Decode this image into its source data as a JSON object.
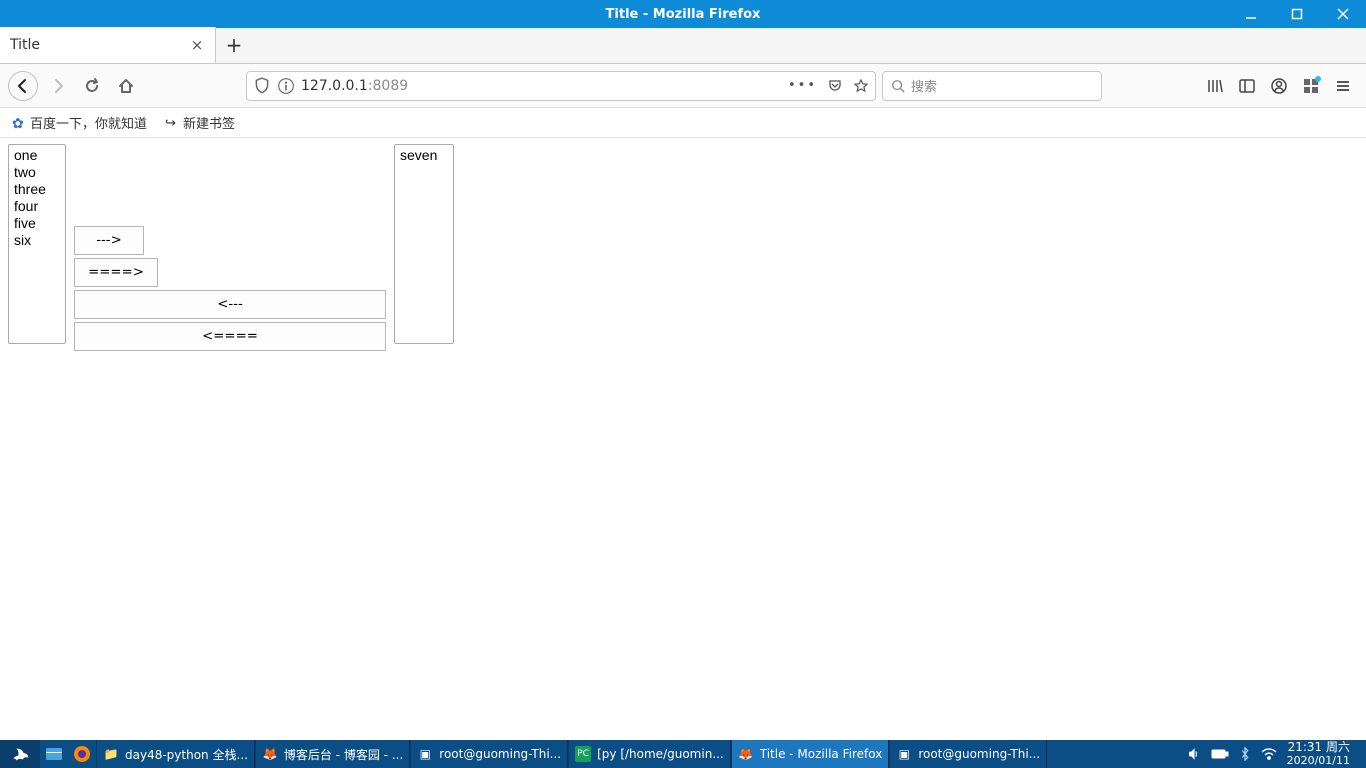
{
  "window": {
    "title": "Title - Mozilla Firefox"
  },
  "tab": {
    "title": "Title"
  },
  "url": {
    "host": "127.0.0.1",
    "port": ":8089"
  },
  "search": {
    "placeholder": "搜索"
  },
  "bookmarks": {
    "baidu": "百度一下，你就知道",
    "newbm": "新建书签"
  },
  "left_list": [
    "one",
    "two",
    "three",
    "four",
    "five",
    "six"
  ],
  "right_list": [
    "seven"
  ],
  "buttons": {
    "right1": "--->",
    "right_all": "====>",
    "left1": "<---",
    "left_all": "<===="
  },
  "tasks": {
    "t1": "day48-python 全栈...",
    "t2": "博客后台 - 博客园 - ...",
    "t3": "root@guoming-Thi...",
    "t4": "[py [/home/guomin...",
    "t5": "Title - Mozilla Firefox",
    "t6": "root@guoming-Thi..."
  },
  "clock": {
    "time": "21:31 周六",
    "date": "2020/01/11"
  }
}
